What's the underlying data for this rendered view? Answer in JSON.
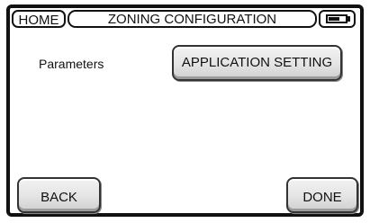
{
  "header": {
    "home_label": "HOME",
    "title": "ZONING CONFIGURATION",
    "battery_level": 0.75
  },
  "main": {
    "parameters_label": "Parameters",
    "application_setting_label": "APPLICATION SETTING"
  },
  "footer": {
    "back_label": "BACK",
    "done_label": "DONE"
  }
}
